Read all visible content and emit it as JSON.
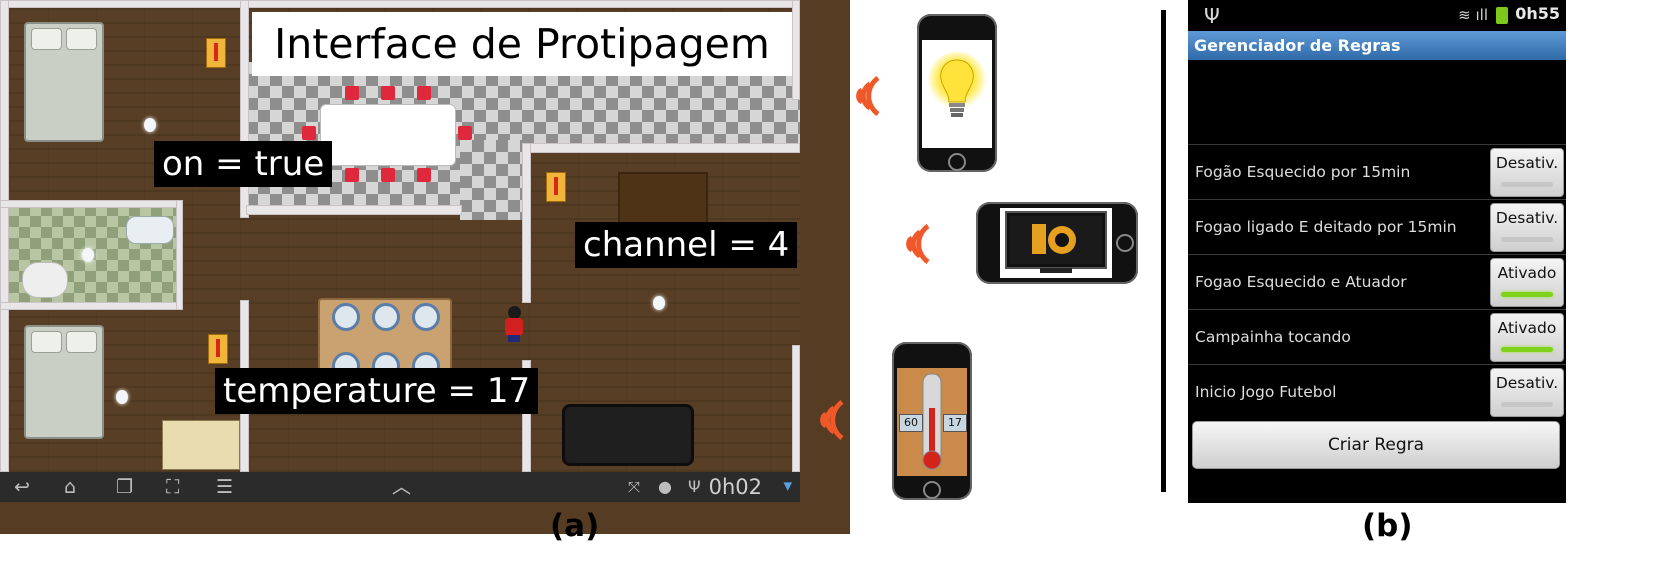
{
  "panel_a": {
    "title": "Interface de Protipagem",
    "labels": {
      "on": "on = true",
      "channel": "channel = 4",
      "temperature": "temperature = 17"
    },
    "navbar": {
      "icons": [
        "back-icon",
        "home-icon",
        "recent-apps-icon",
        "screenshot-icon",
        "menu-icon",
        "up-chevron-icon",
        "expand-icon",
        "android-icon",
        "usb-icon",
        "battery-icon"
      ],
      "clock": "0h02"
    },
    "caption": "(a)"
  },
  "devices": {
    "thermometer": {
      "left_value": "60",
      "right_value": "17"
    }
  },
  "panel_b": {
    "status_bar": {
      "clock": "0h55",
      "icons": [
        "usb-icon",
        "wifi-icon",
        "signal-icon",
        "battery-icon"
      ]
    },
    "title": "Gerenciador de Regras",
    "rules": [
      {
        "label": "Fogão Esquecido por 15min",
        "button": "Desativ.",
        "active": false
      },
      {
        "label": "Fogao ligado E deitado por 15min",
        "button": "Desativ.",
        "active": false
      },
      {
        "label": "Fogao Esquecido e Atuador",
        "button": "Ativado",
        "active": true
      },
      {
        "label": "Campainha tocando",
        "button": "Ativado",
        "active": true
      },
      {
        "label": "Inicio Jogo Futebol",
        "button": "Desativ.",
        "active": false
      }
    ],
    "create_button": "Criar Regra",
    "caption": "(b)"
  },
  "colors": {
    "floor_wood": "#583e24",
    "title_bar_blue": "#3f7fc0",
    "active_indicator": "#7fd11c",
    "wave_orange": "#f0582a"
  }
}
